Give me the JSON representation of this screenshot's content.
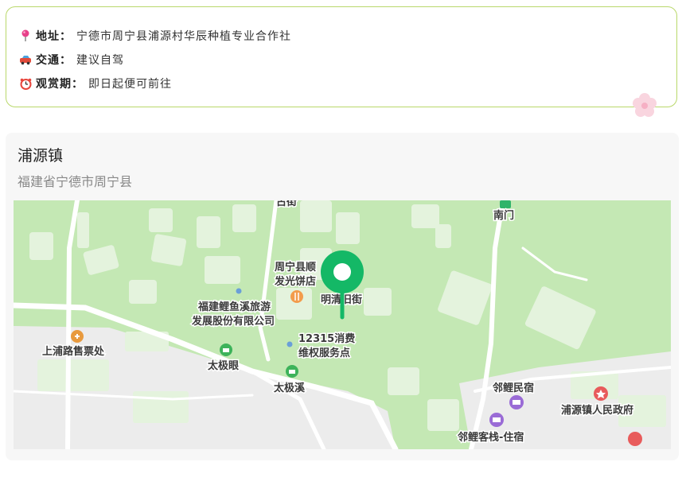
{
  "info": {
    "address": {
      "label": "地址：",
      "value": "宁德市周宁县浦源村华辰种植专业合作社",
      "icon": "pin-icon"
    },
    "traffic": {
      "label": "交通：",
      "value": "建议自驾",
      "icon": "car-icon"
    },
    "period": {
      "label": "观赏期：",
      "value": "即日起便可前往",
      "icon": "alarm-clock-icon"
    }
  },
  "location": {
    "title": "浦源镇",
    "subtitle": "福建省宁德市周宁县"
  },
  "map": {
    "labels": {
      "top_street": "古街",
      "south_gate": "南门",
      "shop_line1": "周宁县顺",
      "shop_line2": "发光饼店",
      "old_street": "明清旧街",
      "tourism_line1": "福建鲤鱼溪旅游",
      "tourism_line2": "发展股份有限公司",
      "consumer_line1": "12315消费",
      "consumer_line2": "维权服务点",
      "ticket": "上浦路售票处",
      "taiji_eye": "太极眼",
      "taiji_stream": "太极溪",
      "linli_inn": "邻鲤民宿",
      "linli_hostel": "邻鲤客栈-住宿",
      "gov": "浦源镇人民政府"
    },
    "colors": {
      "grass": "#c4e8b4",
      "building": "#e6f2e0",
      "road": "#ffffff",
      "pin": "#14b866",
      "poi_green": "#3db35a",
      "poi_orange": "#f39c4c",
      "poi_purple": "#9a6bd6",
      "poi_red": "#e85b5b"
    }
  }
}
